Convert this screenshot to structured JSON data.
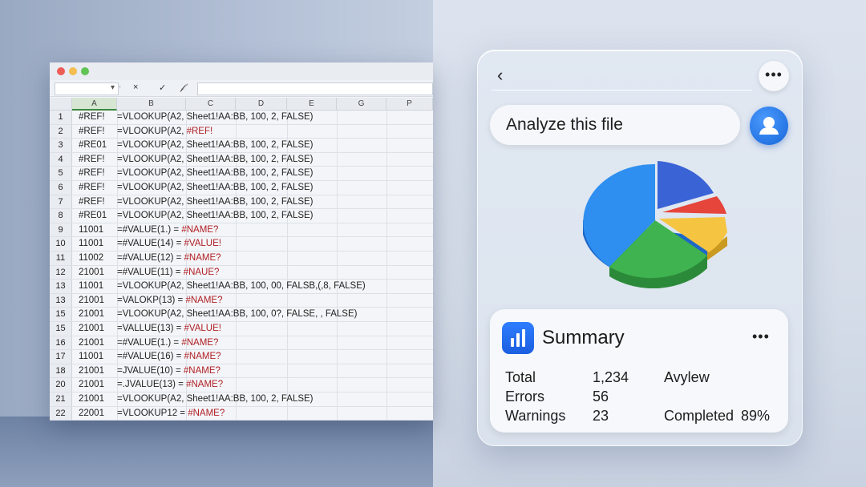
{
  "spreadsheet": {
    "columns": [
      "A",
      "B",
      "C",
      "D",
      "E",
      "G",
      "P"
    ],
    "formula_toolbar": {
      "cancel": "×",
      "confirm": "✓",
      "fx": "𝒻"
    },
    "rows": [
      {
        "n": "1",
        "a": "#REF!",
        "b": "=VLOOKUP(A2, Sheet1!AA:BB, 100, 2, FALSE)",
        "a_err": false,
        "b_err": ""
      },
      {
        "n": "2",
        "a": "#REF!",
        "b": "=VLOOKUP(A2, ",
        "b_err": "#REF!"
      },
      {
        "n": "3",
        "a": "#RE01",
        "b": "=VLOOKUP(A2, Sheet1!AA:BB, 100, 2, FALSE)",
        "b_err": ""
      },
      {
        "n": "4",
        "a": "#REF!",
        "b": "=VLOOKUP(A2, Sheet1!AA:BB, 100, 2, FALSE)",
        "b_err": ""
      },
      {
        "n": "5",
        "a": "#REF!",
        "b": "=VLOOKUP(A2, Sheet1!AA:BB, 100, 2, FALSE)",
        "b_err": ""
      },
      {
        "n": "6",
        "a": "#REF!",
        "b": "=VLOOKUP(A2, Sheet1!AA:BB, 100, 2, FALSE)",
        "b_err": ""
      },
      {
        "n": "7",
        "a": "#REF!",
        "b": "=VLOOKUP(A2, Sheet1!AA:BB, 100, 2, FALSE)",
        "b_err": ""
      },
      {
        "n": "8",
        "a": "#RE01",
        "b": "=VLOOKUP(A2, Sheet1!AA:BB, 100, 2, FALSE)",
        "b_err": ""
      },
      {
        "n": "9",
        "a": "11001",
        "b": "=#VALUE(1.) = ",
        "b_err": "#NAME?"
      },
      {
        "n": "10",
        "a": "11001",
        "b": "=#VALUE(14) = ",
        "b_err": "#VALUE!"
      },
      {
        "n": "11",
        "a": "11002",
        "b": "=#VALUE(12) = ",
        "b_err": "#NAME?"
      },
      {
        "n": "12",
        "a": "21001",
        "b": "=#VALUE(11) = ",
        "b_err": "#NAUE?"
      },
      {
        "n": "13",
        "a": "11001",
        "b": "=VLOOKUP(A2, Sheet1!AA:BB, 100, 00, FALSB,(,8, FALSE)",
        "b_err": ""
      },
      {
        "n": "13",
        "a": "21001",
        "b": "=VALOKP(13) = ",
        "b_err": "#NAME?"
      },
      {
        "n": "15",
        "a": "21001",
        "b": "=VLOOKUP(A2, Sheet1!AA:BB, 100, 0?, FALSE, , FALSE)",
        "b_err": ""
      },
      {
        "n": "15",
        "a": "21001",
        "b": "=VALLUE(13) = ",
        "b_err": "#VALUE!"
      },
      {
        "n": "16",
        "a": "21001",
        "b": "=#VALUE(1.) = ",
        "b_err": "#NAME?"
      },
      {
        "n": "17",
        "a": "11001",
        "b": "=#VALUE(16) = ",
        "b_err": "#NAME?"
      },
      {
        "n": "18",
        "a": "21001",
        "b": "=JVALUE(10) = ",
        "b_err": "#NAME?"
      },
      {
        "n": "20",
        "a": "21001",
        "b": "=.JVALUE(13) = ",
        "b_err": "#NAME?"
      },
      {
        "n": "21",
        "a": "21001",
        "b": "=VLOOKUP(A2, Sheet1!AA:BB, 100, 2, FALSE)",
        "b_err": ""
      },
      {
        "n": "22",
        "a": "22001",
        "b": "=VLOOKUP12 = ",
        "b_err": "#NAME?"
      }
    ]
  },
  "assistant": {
    "back_icon": "‹",
    "menu_icon": "•••",
    "prompt": "Analyze this file",
    "avatar_icon": "user-avatar-icon",
    "pie": {
      "colors": [
        "#3a63d6",
        "#e6453c",
        "#f5c542",
        "#3fb34f",
        "#2e8ff0"
      ]
    },
    "summary": {
      "title": "Summary",
      "more": "•••",
      "total_label": "Total",
      "total_value": "1,234",
      "errors_label": "Errors",
      "errors_value": "56",
      "warnings_label": "Warnings",
      "warnings_value": "23",
      "ayview_label": "Avylew",
      "completed_label": "Completed",
      "completed_value": "89%"
    }
  }
}
